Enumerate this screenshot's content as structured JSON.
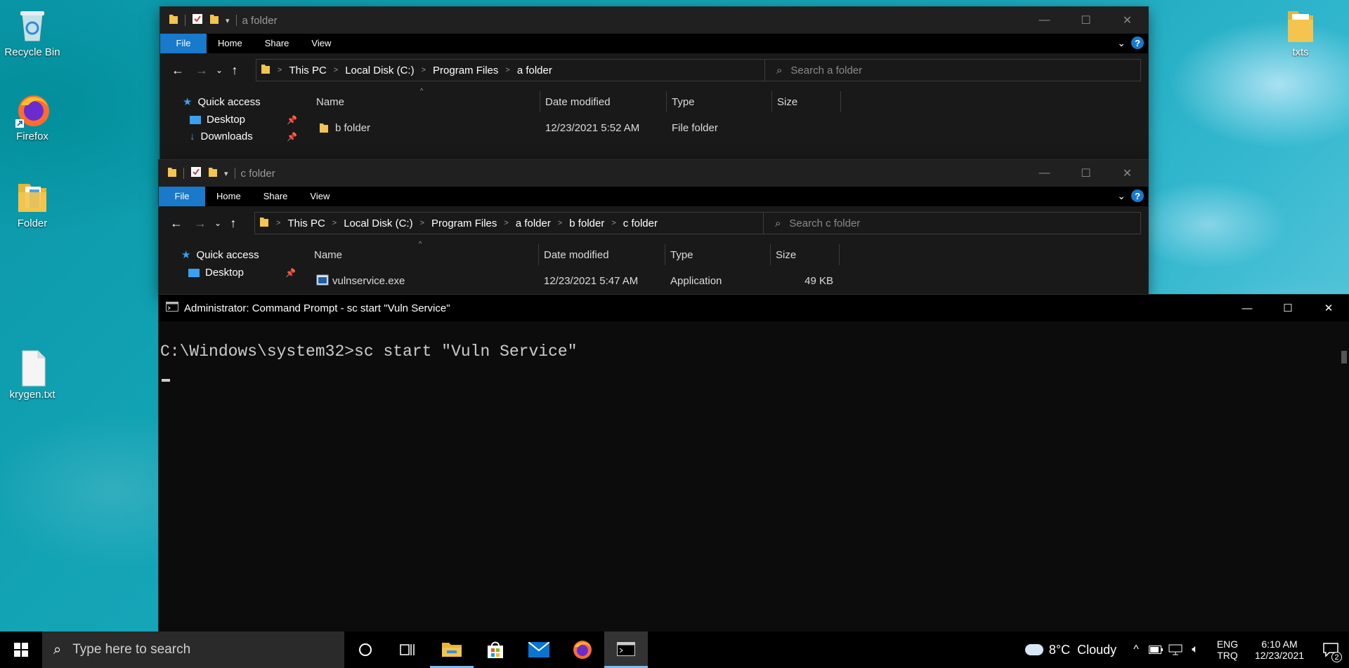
{
  "desktop": {
    "icons": [
      {
        "label": "Recycle Bin",
        "icon": "recycle-bin-icon"
      },
      {
        "label": "Firefox",
        "icon": "firefox-icon"
      },
      {
        "label": "Folder",
        "icon": "folder-icon"
      },
      {
        "label": "krygen.txt",
        "icon": "text-file-icon"
      },
      {
        "label": "txts",
        "icon": "folder-icon"
      }
    ]
  },
  "explorer_a": {
    "title": "a folder",
    "ribbon_tabs": [
      "File",
      "Home",
      "Share",
      "View"
    ],
    "breadcrumbs": [
      "This PC",
      "Local Disk (C:)",
      "Program Files",
      "a folder"
    ],
    "search_placeholder": "Search a folder",
    "nav": [
      {
        "label": "Quick access"
      },
      {
        "label": "Desktop"
      },
      {
        "label": "Downloads"
      }
    ],
    "columns": [
      "Name",
      "Date modified",
      "Type",
      "Size"
    ],
    "rows": [
      {
        "name": "b folder",
        "date": "12/23/2021 5:52 AM",
        "type": "File folder",
        "size": ""
      }
    ]
  },
  "explorer_c": {
    "title": "c folder",
    "ribbon_tabs": [
      "File",
      "Home",
      "Share",
      "View"
    ],
    "breadcrumbs": [
      "This PC",
      "Local Disk (C:)",
      "Program Files",
      "a folder",
      "b folder",
      "c folder"
    ],
    "search_placeholder": "Search c folder",
    "nav": [
      {
        "label": "Quick access"
      },
      {
        "label": "Desktop"
      }
    ],
    "columns": [
      "Name",
      "Date modified",
      "Type",
      "Size"
    ],
    "rows": [
      {
        "name": "vulnservice.exe",
        "date": "12/23/2021 5:47 AM",
        "type": "Application",
        "size": "49 KB"
      }
    ]
  },
  "cmd": {
    "title": "Administrator: Command Prompt - sc  start \"Vuln Service\"",
    "line": "C:\\Windows\\system32>sc start \"Vuln Service\""
  },
  "taskbar": {
    "search_placeholder": "Type here to search",
    "weather": "8°C  Cloudy",
    "lang_1": "ENG",
    "lang_2": "TRQ",
    "time": "6:10 AM",
    "date": "12/23/2021",
    "notifications": "2"
  },
  "colors": {
    "accent": "#1979ca",
    "folder": "#f4c44e"
  }
}
